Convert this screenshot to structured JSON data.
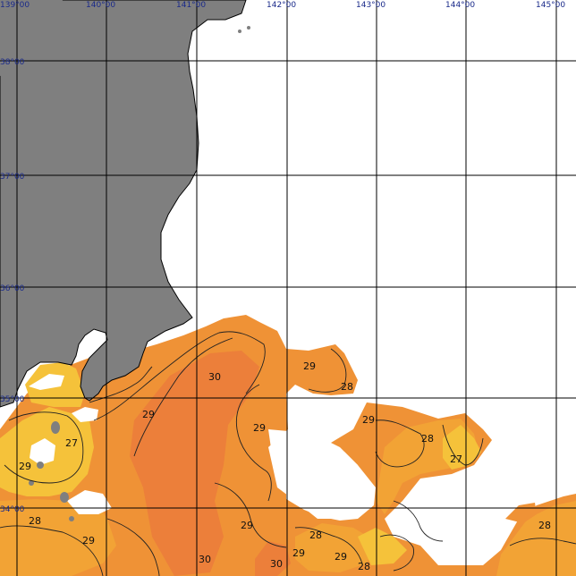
{
  "lon_labels": [
    "139°00",
    "140°00",
    "141°00",
    "142°00",
    "143°00",
    "144°00",
    "145°00"
  ],
  "lat_labels": [
    "38°00",
    "37°00",
    "36°00",
    "35°00",
    "34°00"
  ],
  "colors": {
    "land": "#7f7f7f",
    "no_data": "#ffffff",
    "grid": "#000000",
    "isotherm": "#222222",
    "sst_27": "#f5c23a",
    "sst_28": "#f2a335",
    "sst_29": "#ef9236",
    "sst_30": "#ec7f3a"
  },
  "isotherm_labels": [
    {
      "value": "30"
    },
    {
      "value": "29"
    },
    {
      "value": "28"
    },
    {
      "value": "29"
    },
    {
      "value": "29"
    },
    {
      "value": "29"
    },
    {
      "value": "28"
    },
    {
      "value": "27"
    },
    {
      "value": "27"
    },
    {
      "value": "29"
    },
    {
      "value": "28"
    },
    {
      "value": "29"
    },
    {
      "value": "29"
    },
    {
      "value": "28"
    },
    {
      "value": "30"
    },
    {
      "value": "30"
    },
    {
      "value": "29"
    },
    {
      "value": "29"
    },
    {
      "value": "28"
    },
    {
      "value": "28"
    }
  ]
}
